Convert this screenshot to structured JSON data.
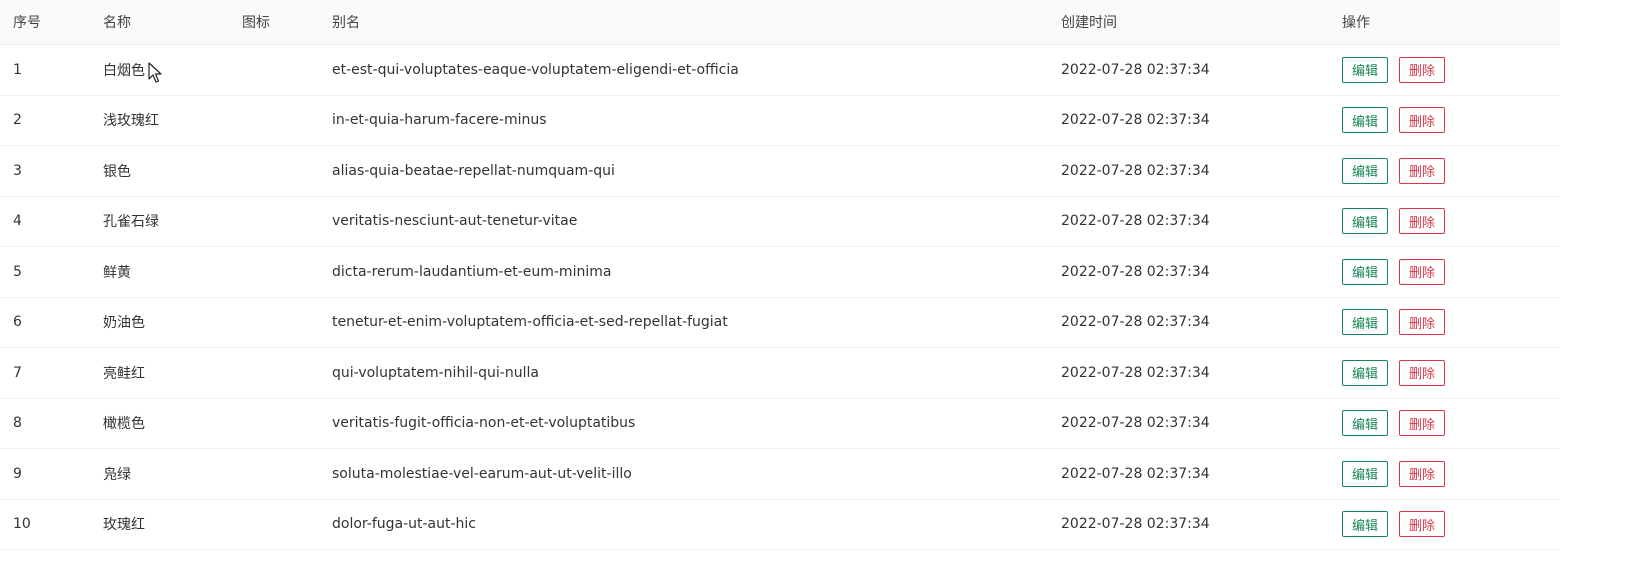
{
  "table": {
    "columns": {
      "index": "序号",
      "name": "名称",
      "icon": "图标",
      "alias": "别名",
      "created": "创建时间",
      "actions": "操作"
    },
    "edit_label": "编辑",
    "delete_label": "删除",
    "rows": [
      {
        "index": "1",
        "name": "白烟色",
        "alias": "et-est-qui-voluptates-eaque-voluptatem-eligendi-et-officia",
        "created": "2022-07-28 02:37:34"
      },
      {
        "index": "2",
        "name": "浅玫瑰红",
        "alias": "in-et-quia-harum-facere-minus",
        "created": "2022-07-28 02:37:34"
      },
      {
        "index": "3",
        "name": "银色",
        "alias": "alias-quia-beatae-repellat-numquam-qui",
        "created": "2022-07-28 02:37:34"
      },
      {
        "index": "4",
        "name": "孔雀石绿",
        "alias": "veritatis-nesciunt-aut-tenetur-vitae",
        "created": "2022-07-28 02:37:34"
      },
      {
        "index": "5",
        "name": "鲜黄",
        "alias": "dicta-rerum-laudantium-et-eum-minima",
        "created": "2022-07-28 02:37:34"
      },
      {
        "index": "6",
        "name": "奶油色",
        "alias": "tenetur-et-enim-voluptatem-officia-et-sed-repellat-fugiat",
        "created": "2022-07-28 02:37:34"
      },
      {
        "index": "7",
        "name": "亮鲑红",
        "alias": "qui-voluptatem-nihil-qui-nulla",
        "created": "2022-07-28 02:37:34"
      },
      {
        "index": "8",
        "name": "橄榄色",
        "alias": "veritatis-fugit-officia-non-et-et-voluptatibus",
        "created": "2022-07-28 02:37:34"
      },
      {
        "index": "9",
        "name": "凫绿",
        "alias": "soluta-molestiae-vel-earum-aut-ut-velit-illo",
        "created": "2022-07-28 02:37:34"
      },
      {
        "index": "10",
        "name": "玫瑰红",
        "alias": "dolor-fuga-ut-aut-hic",
        "created": "2022-07-28 02:37:34"
      }
    ]
  },
  "colors": {
    "edit": "#198754",
    "delete": "#dc3545",
    "header_bg": "#fafafa",
    "row_border": "#ebeef5"
  },
  "cursor_icon": "mouse-pointer-icon"
}
